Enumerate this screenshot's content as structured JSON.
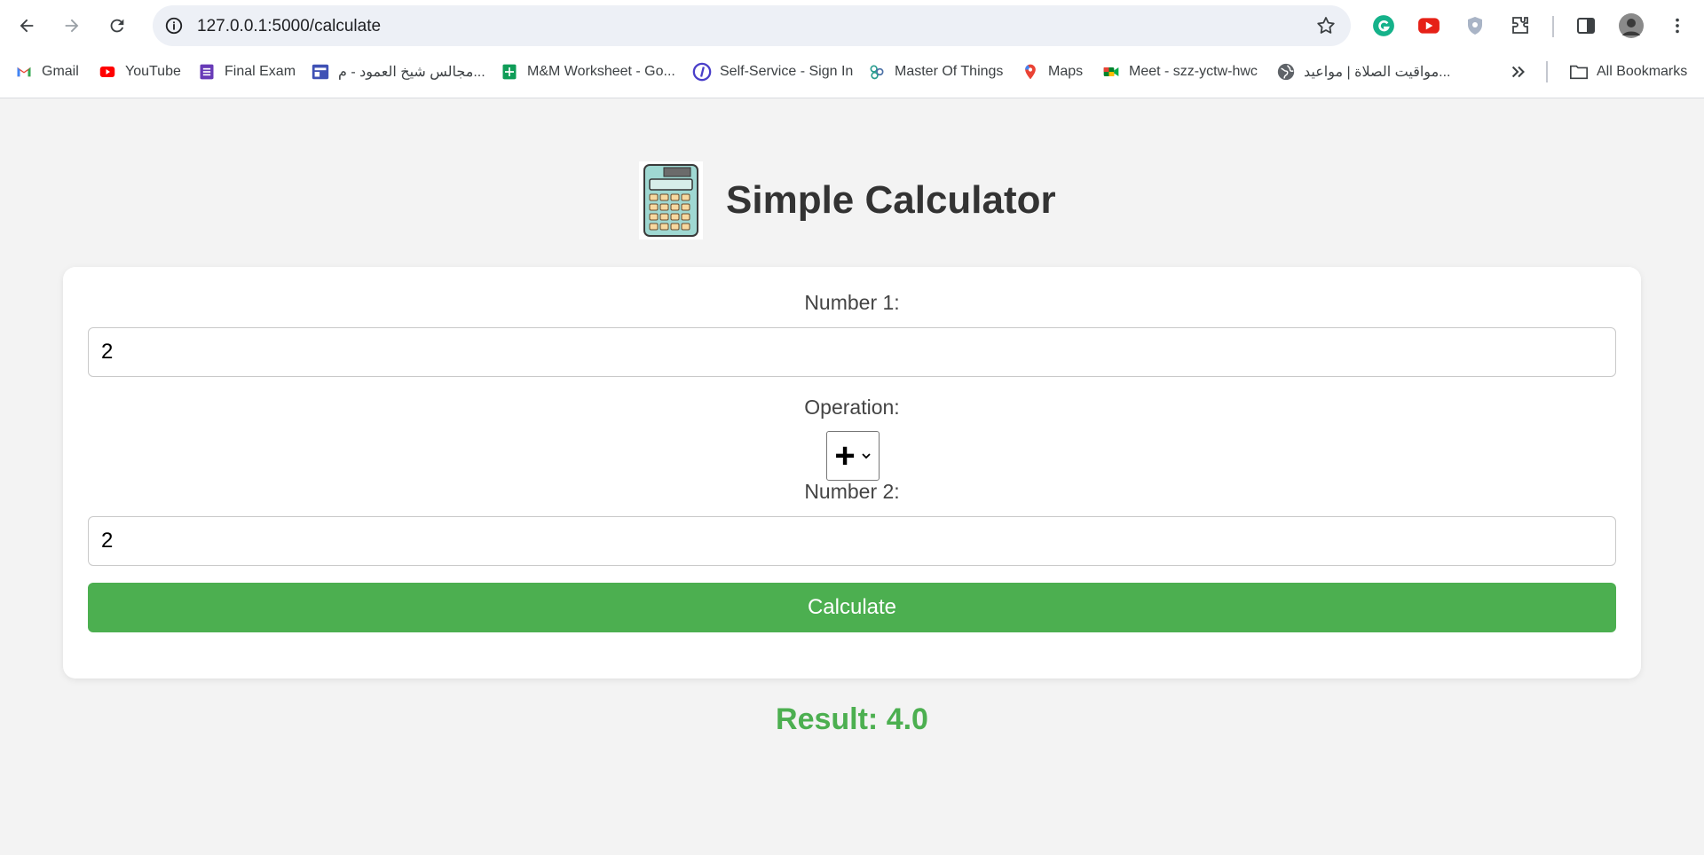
{
  "browser": {
    "url": "127.0.0.1:5000/calculate",
    "bookmarks": [
      {
        "label": "Gmail",
        "icon": "gmail-icon"
      },
      {
        "label": "YouTube",
        "icon": "youtube-icon"
      },
      {
        "label": "Final Exam",
        "icon": "forms-icon"
      },
      {
        "label": "مجالس شيخ العمود - م...",
        "icon": "sites-icon"
      },
      {
        "label": "M&M Worksheet - Go...",
        "icon": "sheets-icon"
      },
      {
        "label": "Self-Service - Sign In",
        "icon": "selfservice-icon"
      },
      {
        "label": "Master Of Things",
        "icon": "mot-icon"
      },
      {
        "label": "Maps",
        "icon": "maps-icon"
      },
      {
        "label": "Meet - szz-yctw-hwc",
        "icon": "meet-icon"
      },
      {
        "label": "مواقيت الصلاة | مواعيد...",
        "icon": "globe-icon"
      }
    ],
    "all_bookmarks": "All Bookmarks"
  },
  "app": {
    "title": "Simple Calculator",
    "number1_label": "Number 1:",
    "number1_value": "2",
    "operation_label": "Operation:",
    "operation_value": "+",
    "number2_label": "Number 2:",
    "number2_value": "2",
    "calculate_label": "Calculate",
    "result_text": "Result: 4.0"
  },
  "colors": {
    "accent": "#4caf50",
    "background": "#f3f3f3",
    "card": "#ffffff"
  }
}
